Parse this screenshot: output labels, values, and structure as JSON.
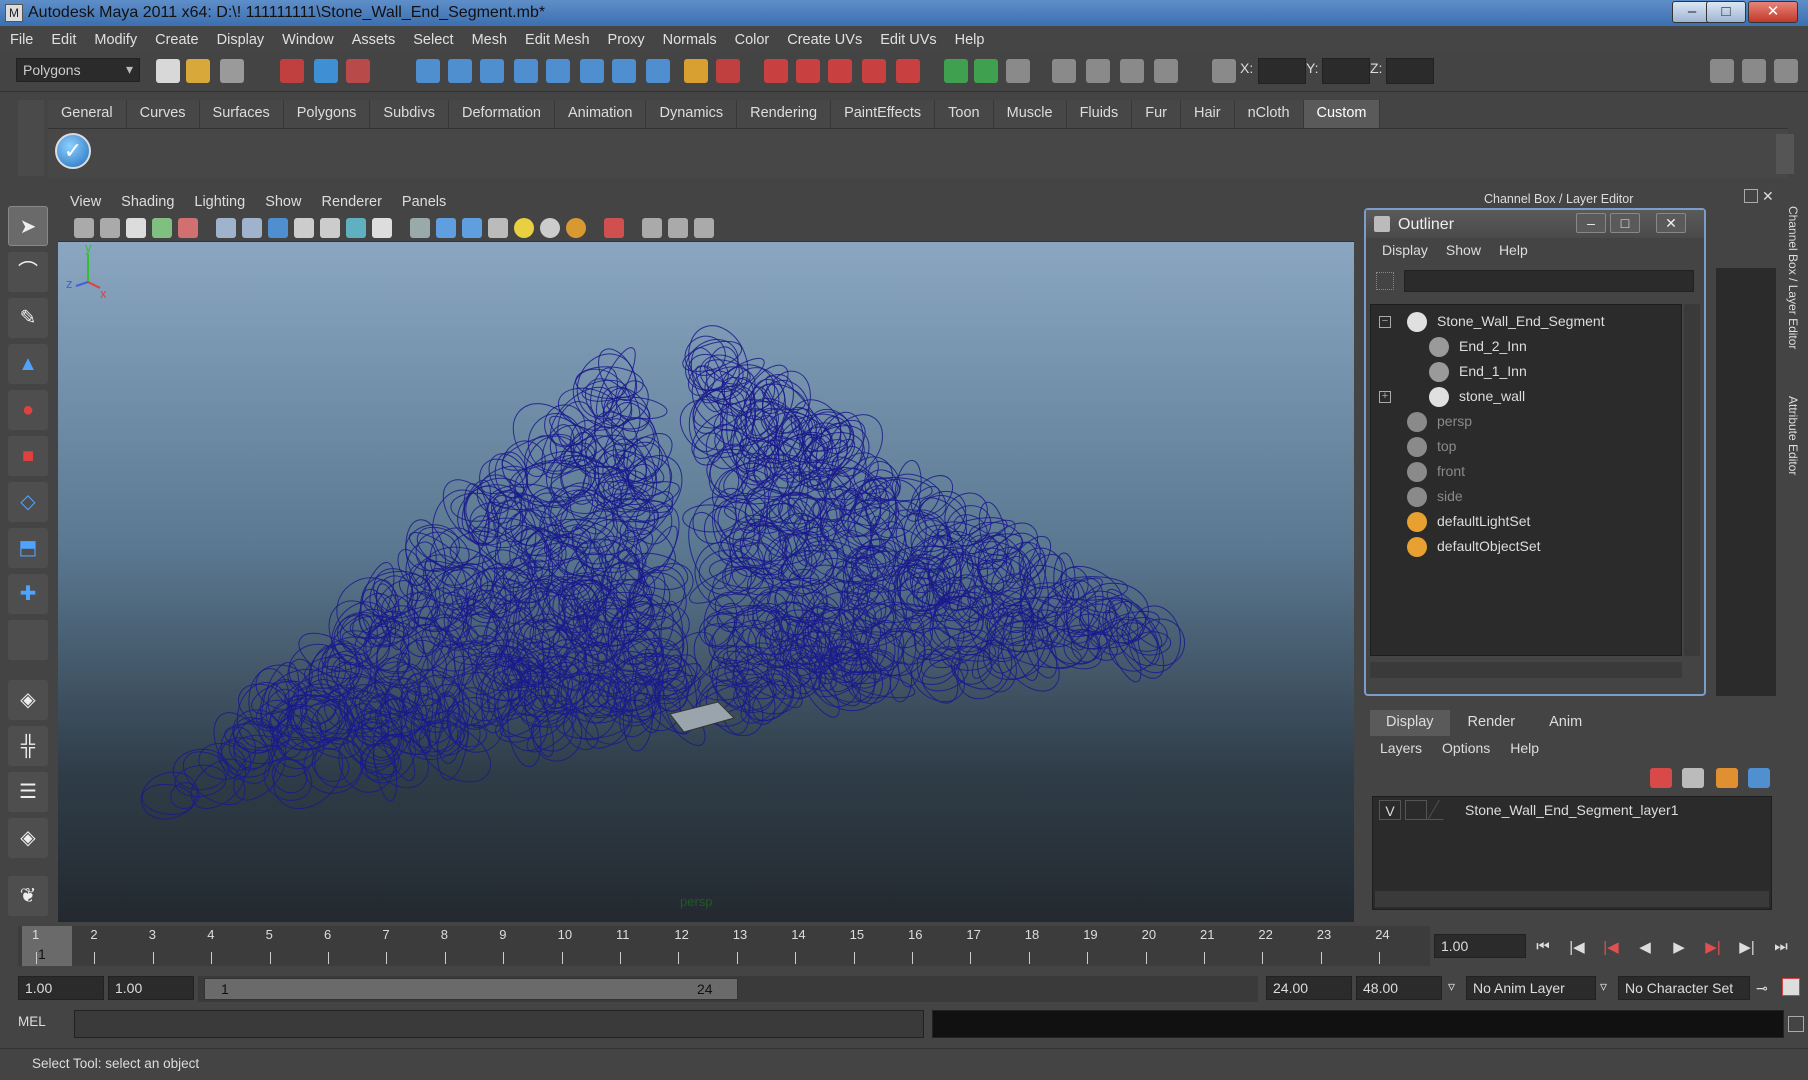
{
  "window": {
    "title": "Autodesk Maya 2011 x64: D:\\! 111111111\\Stone_Wall_End_Segment.mb*",
    "minimize": "–",
    "maximize": "□",
    "close": "✕"
  },
  "menubar": [
    "File",
    "Edit",
    "Modify",
    "Create",
    "Display",
    "Window",
    "Assets",
    "Select",
    "Mesh",
    "Edit Mesh",
    "Proxy",
    "Normals",
    "Color",
    "Create UVs",
    "Edit UVs",
    "Help"
  ],
  "statusline": {
    "menuset": "Polygons",
    "x_label": "X:",
    "y_label": "Y:",
    "z_label": "Z:"
  },
  "shelf": {
    "tabs": [
      "General",
      "Curves",
      "Surfaces",
      "Polygons",
      "Subdivs",
      "Deformation",
      "Animation",
      "Dynamics",
      "Rendering",
      "PaintEffects",
      "Toon",
      "Muscle",
      "Fluids",
      "Fur",
      "Hair",
      "nCloth",
      "Custom"
    ],
    "active_tab": "Custom",
    "check_glyph": "✓"
  },
  "viewport": {
    "menu": [
      "View",
      "Shading",
      "Lighting",
      "Show",
      "Renderer",
      "Panels"
    ],
    "camera_label": "persp",
    "axis_y": "y",
    "axis_z": "z",
    "axis_x": "x",
    "wire_color": "#1a1a8c"
  },
  "channelbox": {
    "title": "Channel Box / Layer Editor",
    "side_tab_1": "Channel Box / Layer Editor",
    "side_tab_2": "Attribute Editor"
  },
  "outliner": {
    "title": "Outliner",
    "menu": [
      "Display",
      "Show",
      "Help"
    ],
    "items": [
      {
        "label": "Stone_Wall_End_Segment",
        "icon": "transform-icon",
        "dim": false
      },
      {
        "label": "End_2_Inn",
        "icon": "mesh-icon",
        "dim": false
      },
      {
        "label": "End_1_Inn",
        "icon": "mesh-icon",
        "dim": false
      },
      {
        "label": "stone_wall",
        "icon": "transform-icon",
        "dim": false
      },
      {
        "label": "persp",
        "icon": "camera-icon",
        "dim": true
      },
      {
        "label": "top",
        "icon": "camera-icon",
        "dim": true
      },
      {
        "label": "front",
        "icon": "camera-icon",
        "dim": true
      },
      {
        "label": "side",
        "icon": "camera-icon",
        "dim": true
      },
      {
        "label": "defaultLightSet",
        "icon": "set-icon",
        "dim": false
      },
      {
        "label": "defaultObjectSet",
        "icon": "set-icon",
        "dim": false
      }
    ],
    "collapse_glyph": "−",
    "expand_glyph": "+"
  },
  "layer_editor": {
    "tabs": [
      "Display",
      "Render",
      "Anim"
    ],
    "active_tab": "Display",
    "menu": [
      "Layers",
      "Options",
      "Help"
    ],
    "layer_visible": "V",
    "layer_name": "Stone_Wall_End_Segment_layer1"
  },
  "timeslider": {
    "ticks": [
      "1",
      "2",
      "3",
      "4",
      "5",
      "6",
      "7",
      "8",
      "9",
      "10",
      "11",
      "12",
      "13",
      "14",
      "15",
      "16",
      "17",
      "18",
      "19",
      "20",
      "21",
      "22",
      "23",
      "24"
    ],
    "current_frame_marker": "1",
    "current_time": "1.00"
  },
  "range": {
    "start_time": "1.00",
    "start_range": "1.00",
    "bar_start": "1",
    "bar_end": "24",
    "end_range": "24.00",
    "end_time": "48.00",
    "anim_layer": "No Anim Layer",
    "character_set": "No Character Set"
  },
  "commandline": {
    "label": "MEL"
  },
  "helpline": {
    "text": "Select Tool: select an object"
  }
}
